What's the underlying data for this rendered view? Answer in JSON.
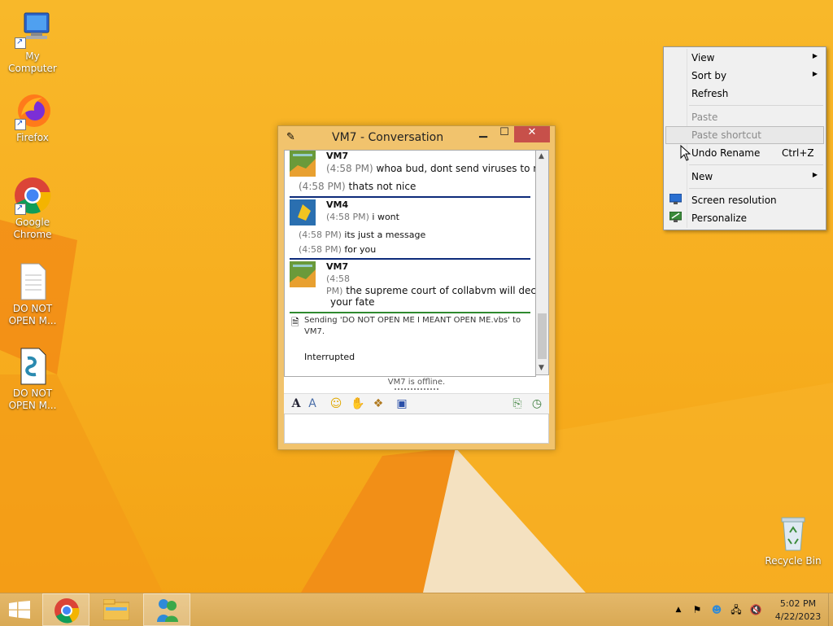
{
  "desktop": {
    "icons": [
      {
        "label": "My Computer"
      },
      {
        "label": "Firefox"
      },
      {
        "label": "Google Chrome"
      },
      {
        "label": "DO NOT OPEN M..."
      },
      {
        "label": "DO NOT OPEN M..."
      },
      {
        "label": "Recycle Bin"
      }
    ]
  },
  "conversation": {
    "title": "VM7 - Conversation",
    "minimize": "▁",
    "maximize": "☐",
    "close": "✕",
    "messages": [
      {
        "sender": "VM7",
        "lines": [
          {
            "time": "(4:58 PM)",
            "text": "whoa bud, dont send viruses to me"
          },
          {
            "time": "(4:58 PM)",
            "text": "thats not nice"
          }
        ]
      },
      {
        "sender": "VM4",
        "lines": [
          {
            "time": "(4:58 PM)",
            "text": "i wont"
          },
          {
            "time": "(4:58 PM)",
            "text": "its just a message"
          },
          {
            "time": "(4:58 PM)",
            "text": "for you"
          }
        ]
      },
      {
        "sender": "VM7",
        "lines": [
          {
            "time": "(4:58",
            "text": ""
          },
          {
            "time": "PM)",
            "text": "the supreme court of collabvm will decide"
          },
          {
            "time": "",
            "text": "your fate"
          }
        ]
      }
    ],
    "transfer": {
      "line1": "Sending 'DO NOT OPEN ME I MEANT OPEN ME.vbs' to",
      "line2": "VM7.",
      "status": "Interrupted"
    },
    "status_text": "VM7 is offline."
  },
  "context_menu": {
    "items": [
      {
        "label": "View"
      },
      {
        "label": "Sort by"
      },
      {
        "label": "Refresh"
      },
      {
        "label": "Paste"
      },
      {
        "label": "Paste shortcut"
      },
      {
        "label": "Undo Rename",
        "shortcut": "Ctrl+Z"
      },
      {
        "label": "New"
      },
      {
        "label": "Screen resolution"
      },
      {
        "label": "Personalize"
      }
    ]
  },
  "taskbar": {
    "time": "5:02 PM",
    "date": "4/22/2023"
  },
  "colors": {
    "accent_blue": "#0d2b7a",
    "accent_green": "#2f8a2f",
    "close_red": "#c7504a"
  }
}
